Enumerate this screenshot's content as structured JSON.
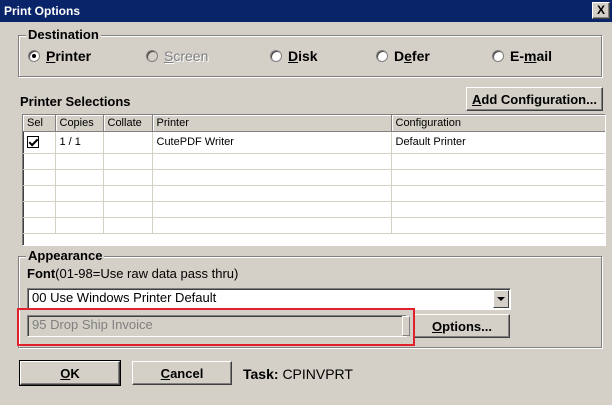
{
  "window": {
    "title": "Print Options",
    "close_label": "X"
  },
  "destination": {
    "legend": "Destination",
    "options": [
      {
        "pre": "",
        "u": "P",
        "post": "rinter",
        "checked": true,
        "disabled": false
      },
      {
        "pre": "",
        "u": "S",
        "post": "creen",
        "checked": false,
        "disabled": true
      },
      {
        "pre": "",
        "u": "D",
        "post": "isk",
        "checked": false,
        "disabled": false
      },
      {
        "pre": "D",
        "u": "e",
        "post": "fer",
        "checked": false,
        "disabled": false
      },
      {
        "pre": "E-",
        "u": "m",
        "post": "ail",
        "checked": false,
        "disabled": false
      }
    ]
  },
  "printer_selections": {
    "label": "Printer Selections",
    "add_button": {
      "u": "A",
      "post": "dd Configuration..."
    },
    "columns": [
      "Sel",
      "Copies",
      "Collate",
      "Printer",
      "Configuration"
    ],
    "rows": [
      {
        "sel": true,
        "copies": "1 / 1",
        "collate": "",
        "printer": "CutePDF Writer",
        "configuration": "Default Printer"
      }
    ]
  },
  "appearance": {
    "legend": "Appearance",
    "font_label": "Font",
    "font_hint": "(01-98=Use raw data pass thru)",
    "font_value": "00 Use Windows Printer Default",
    "form_value": "95 Drop Ship Invoice",
    "options_button": {
      "u": "O",
      "post": "ptions..."
    }
  },
  "footer": {
    "ok": {
      "u": "O",
      "post": "K"
    },
    "cancel": {
      "u": "C",
      "post": "ancel"
    },
    "task_label": "Task:",
    "task_value": "CPINVPRT"
  }
}
